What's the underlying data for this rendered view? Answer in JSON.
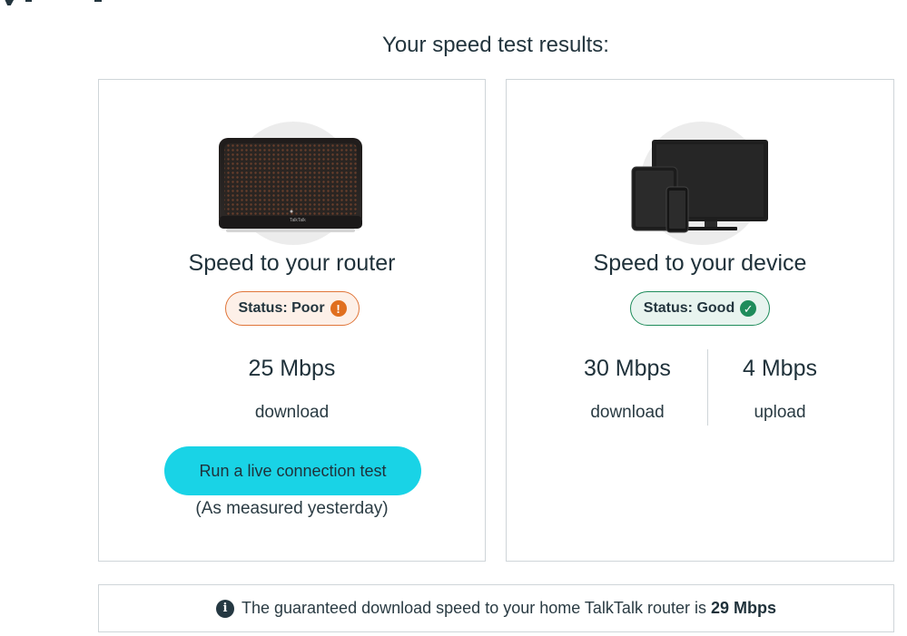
{
  "page": {
    "heading": "Your speed test results:"
  },
  "router_card": {
    "title": "Speed to your router",
    "status": {
      "label": "Status: Poor",
      "level": "poor",
      "icon": "exclamation-icon",
      "color": "#e06f1f"
    },
    "metric": {
      "value": "25 Mbps",
      "label": "download"
    },
    "cta_label": "Run a live connection test",
    "measured_note": "(As measured yesterday)",
    "image": "router-icon"
  },
  "device_card": {
    "title": "Speed to your device",
    "status": {
      "label": "Status: Good",
      "level": "good",
      "icon": "checkmark-icon",
      "color": "#1f8c5b"
    },
    "download": {
      "value": "30 Mbps",
      "label": "download"
    },
    "upload": {
      "value": "4 Mbps",
      "label": "upload"
    },
    "image": "devices-icon"
  },
  "info_bar": {
    "icon": "info-icon",
    "text": "The guaranteed download speed to your home TalkTalk router is",
    "value": "29 Mbps"
  },
  "colors": {
    "accent_button": "#19d3e6",
    "poor": "#e06f1f",
    "good": "#1f8c5b",
    "border": "#cfd5d9"
  }
}
